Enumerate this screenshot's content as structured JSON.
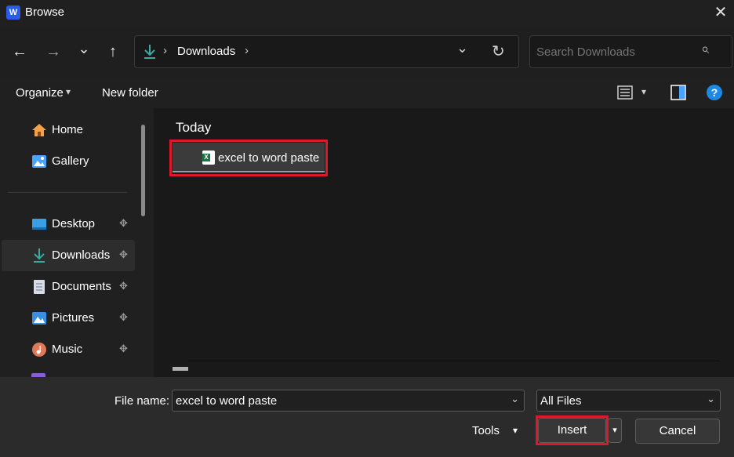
{
  "window": {
    "app_icon": "W",
    "title": "Browse",
    "close_glyph": "✕"
  },
  "nav": {
    "back_glyph": "←",
    "forward_glyph": "→",
    "recent_glyph": "⌄",
    "up_glyph": "↑",
    "address": {
      "separator_glyph": "›",
      "crumbs": [
        "Downloads"
      ],
      "dropdown_glyph": "⌄",
      "refresh_glyph": "↻"
    },
    "search": {
      "placeholder": "Search Downloads",
      "icon_glyph": "⌕"
    }
  },
  "commandbar": {
    "organize_label": "Organize",
    "organize_caret": "▾",
    "new_folder_label": "New folder",
    "view_caret": "▾",
    "help_glyph": "?"
  },
  "sidebar": {
    "pin_glyph": "📌",
    "items": [
      {
        "label": "Home",
        "icon": "home-icon"
      },
      {
        "label": "Gallery",
        "icon": "gallery-icon"
      },
      {
        "label": "Desktop",
        "icon": "desktop-icon",
        "pinned": true
      },
      {
        "label": "Downloads",
        "icon": "downloads-icon",
        "pinned": true,
        "selected": true
      },
      {
        "label": "Documents",
        "icon": "documents-icon",
        "pinned": true
      },
      {
        "label": "Pictures",
        "icon": "pictures-icon",
        "pinned": true
      },
      {
        "label": "Music",
        "icon": "music-icon",
        "pinned": true
      }
    ]
  },
  "content": {
    "group_label": "Today",
    "files": [
      {
        "name": "excel to word paste",
        "type": "excel",
        "badge": "X"
      }
    ]
  },
  "footer": {
    "filename_label": "File name:",
    "filename_value": "excel to word paste",
    "filetype_value": "All Files",
    "chevron_glyph": "⌄",
    "tools_label": "Tools",
    "tools_caret": "▾",
    "insert_label": "Insert",
    "insert_caret": "▾",
    "cancel_label": "Cancel"
  },
  "colors": {
    "highlight": "#e0162b",
    "accent": "#3aa9a1",
    "help": "#1e88e5",
    "excel": "#1f7244"
  }
}
